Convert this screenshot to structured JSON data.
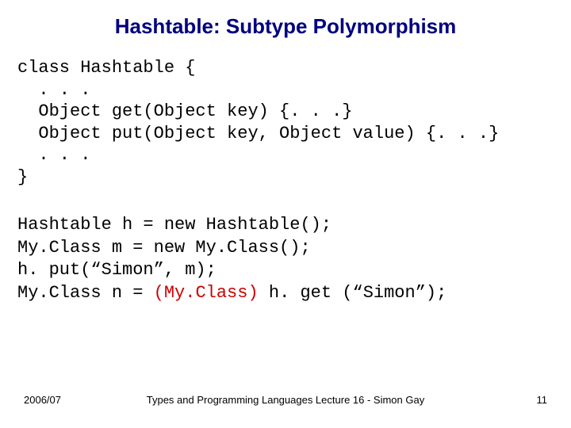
{
  "title": "Hashtable: Subtype Polymorphism",
  "code1": {
    "l1": "class Hashtable {",
    "l2": "  . . .",
    "l3": "  Object get(Object key) {. . .}",
    "l4": "  Object put(Object key, Object value) {. . .}",
    "l5": "  . . .",
    "l6": "}"
  },
  "code2": {
    "l1": "Hashtable h = new Hashtable();",
    "l2": "My.Class m = new My.Class();",
    "l3": "h. put(“Simon”, m);",
    "l4a": "My.Class n = ",
    "l4_cast": "(My.Class)",
    "l4b": " h. get (“Simon”);"
  },
  "footer": {
    "left": "2006/07",
    "center": "Types and Programming Languages Lecture 16 - Simon Gay",
    "right": "11"
  }
}
